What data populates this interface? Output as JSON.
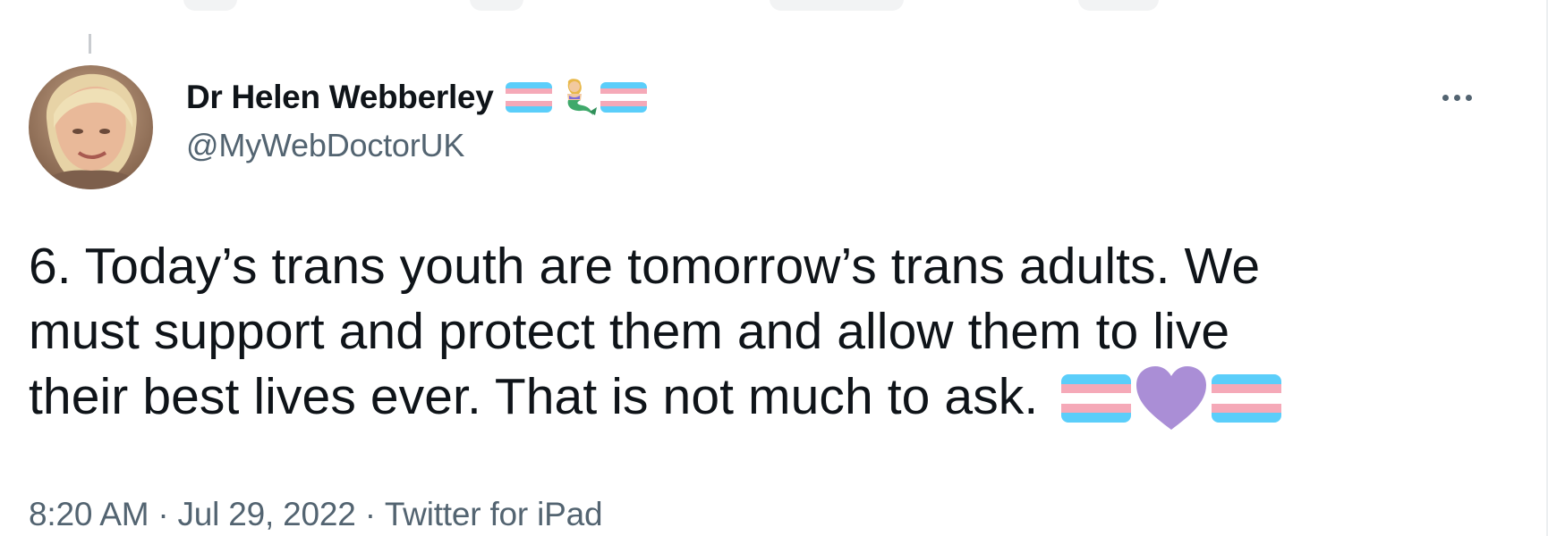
{
  "tweet": {
    "author": {
      "display_name": "Dr Helen Webberley",
      "name_emojis": [
        "transgender-flag",
        "merperson",
        "transgender-flag"
      ],
      "handle": "@MyWebDoctorUK"
    },
    "text_lines": [
      "6. Today’s trans youth are tomorrow’s trans adults. We",
      "must support and protect them and allow them to live",
      "their best lives ever. That is not much to ask."
    ],
    "text_emojis": [
      "transgender-flag",
      "purple-heart",
      "transgender-flag"
    ],
    "meta": {
      "time": "8:20 AM",
      "separator": "·",
      "date": "Jul 29, 2022",
      "source": "Twitter for iPad"
    }
  },
  "colors": {
    "text_primary": "#0f1419",
    "text_secondary": "#536471",
    "trans_blue": "#5bcefa",
    "trans_pink": "#f5a9b8",
    "trans_white": "#ffffff",
    "purple_heart": "#aa8ed6"
  }
}
